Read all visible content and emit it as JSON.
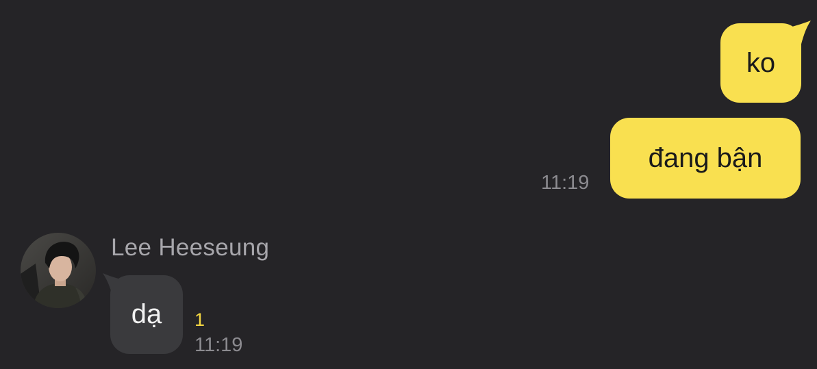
{
  "theme": {
    "background": "#252427",
    "outgoing_bubble": "#f9e050",
    "incoming_bubble": "#3a3a3d",
    "unread_color": "#f5d842",
    "time_color": "#8c8b90"
  },
  "messages": {
    "outgoing": [
      {
        "text": "ko"
      },
      {
        "text": "đang bận",
        "time": "11:19"
      }
    ],
    "incoming": {
      "sender": "Lee Heeseung",
      "text": "dạ",
      "unread_count": "1",
      "time": "11:19",
      "avatar_icon": "profile-photo"
    }
  }
}
